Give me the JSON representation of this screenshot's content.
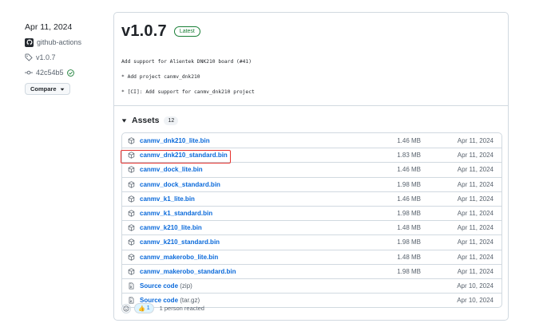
{
  "meta": {
    "date": "Apr 11, 2024",
    "author": "github-actions",
    "tag": "v1.0.7",
    "commit": "42c54b5",
    "compare_label": "Compare"
  },
  "release": {
    "title": "v1.0.7",
    "badge": "Latest",
    "notes": [
      "Add support for Alientek DNK210 board (#41)",
      "* Add project canmv_dnk210",
      "* [CI]: Add support for canmv_dnk210 project"
    ]
  },
  "assets": {
    "title": "Assets",
    "count": "12",
    "items": [
      {
        "name": "canmv_dnk210_lite.bin",
        "ext": "",
        "size": "1.46 MB",
        "date": "Apr 11, 2024",
        "icon": "package-icon"
      },
      {
        "name": "canmv_dnk210_standard.bin",
        "ext": "",
        "size": "1.83 MB",
        "date": "Apr 11, 2024",
        "icon": "package-icon"
      },
      {
        "name": "canmv_dock_lite.bin",
        "ext": "",
        "size": "1.46 MB",
        "date": "Apr 11, 2024",
        "icon": "package-icon"
      },
      {
        "name": "canmv_dock_standard.bin",
        "ext": "",
        "size": "1.98 MB",
        "date": "Apr 11, 2024",
        "icon": "package-icon"
      },
      {
        "name": "canmv_k1_lite.bin",
        "ext": "",
        "size": "1.46 MB",
        "date": "Apr 11, 2024",
        "icon": "package-icon"
      },
      {
        "name": "canmv_k1_standard.bin",
        "ext": "",
        "size": "1.98 MB",
        "date": "Apr 11, 2024",
        "icon": "package-icon"
      },
      {
        "name": "canmv_k210_lite.bin",
        "ext": "",
        "size": "1.48 MB",
        "date": "Apr 11, 2024",
        "icon": "package-icon"
      },
      {
        "name": "canmv_k210_standard.bin",
        "ext": "",
        "size": "1.98 MB",
        "date": "Apr 11, 2024",
        "icon": "package-icon"
      },
      {
        "name": "canmv_makerobo_lite.bin",
        "ext": "",
        "size": "1.48 MB",
        "date": "Apr 11, 2024",
        "icon": "package-icon"
      },
      {
        "name": "canmv_makerobo_standard.bin",
        "ext": "",
        "size": "1.98 MB",
        "date": "Apr 11, 2024",
        "icon": "package-icon"
      },
      {
        "name": "Source code",
        "ext": "(zip)",
        "size": "",
        "date": "Apr 10, 2024",
        "icon": "file-zip-icon"
      },
      {
        "name": "Source code",
        "ext": "(tar.gz)",
        "size": "",
        "date": "Apr 10, 2024",
        "icon": "file-zip-icon"
      }
    ]
  },
  "reactions": {
    "emoji": "👍",
    "count": "1",
    "text": "1 person reacted"
  },
  "colors": {
    "link": "#0969da",
    "latest": "#1a7f37",
    "highlight": "#e5322d",
    "border": "#d1d9e0"
  }
}
